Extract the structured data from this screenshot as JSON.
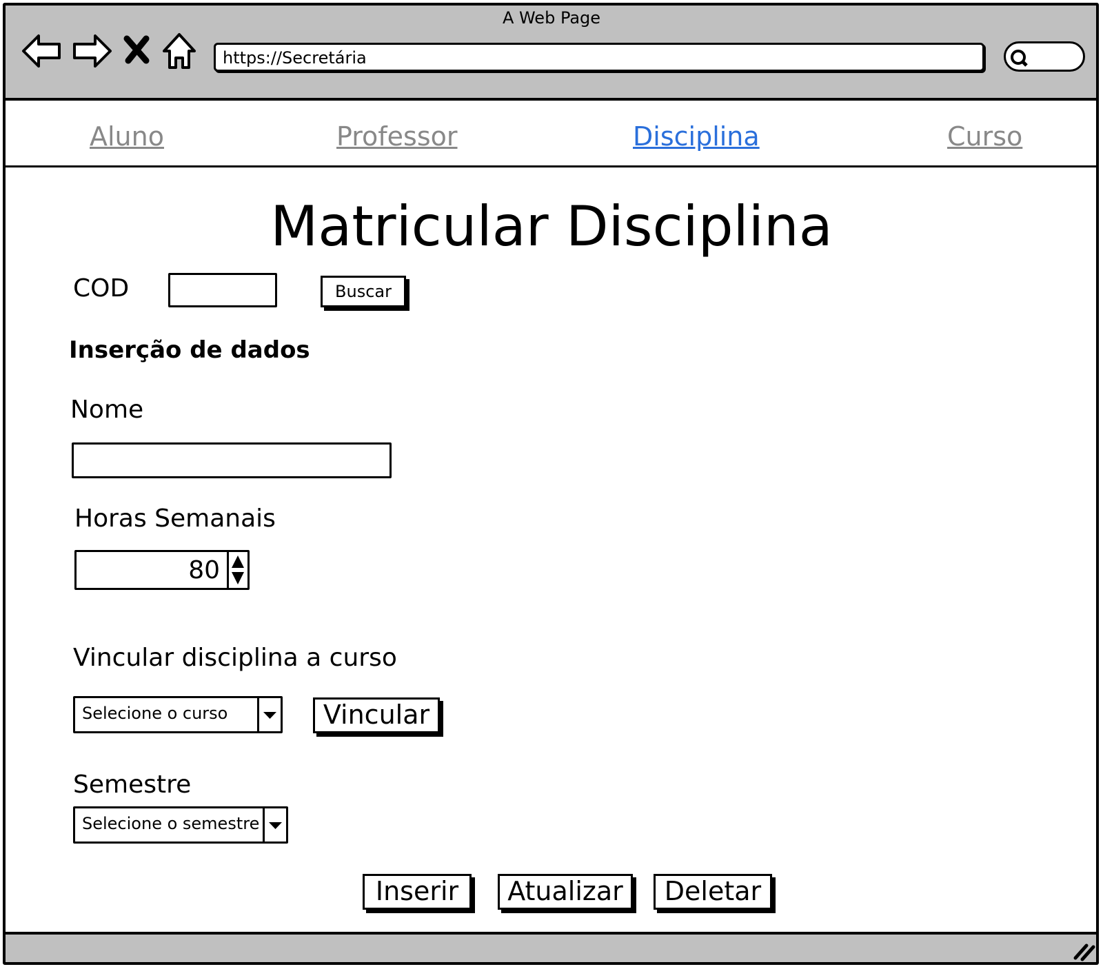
{
  "window": {
    "title": "A Web Page"
  },
  "browser": {
    "url": "https://Secretária",
    "icons": [
      "back-icon",
      "forward-icon",
      "close-icon",
      "home-icon",
      "search-icon",
      "resize-grip-icon"
    ]
  },
  "tabs": [
    {
      "label": "Aluno",
      "active": false
    },
    {
      "label": "Professor",
      "active": false
    },
    {
      "label": "Disciplina",
      "active": true
    },
    {
      "label": "Curso",
      "active": false
    }
  ],
  "page": {
    "title": "Matricular Disciplina",
    "cod_label": "COD",
    "cod_value": "",
    "search_button": "Buscar",
    "section_heading": "Inserção de dados",
    "nome_label": "Nome",
    "nome_value": "",
    "horas_label": "Horas Semanais",
    "horas_value": "80",
    "vincular_label": "Vincular disciplina a curso",
    "curso_select": "Selecione o curso",
    "vincular_button": "Vincular",
    "semestre_label": "Semestre",
    "semestre_select": "Selecione o semestre",
    "actions": {
      "insert": "Inserir",
      "update": "Atualizar",
      "delete": "Deletar"
    }
  },
  "colors": {
    "chrome": "#c0c0c0",
    "active_tab": "#2a6fdb",
    "inactive_tab": "#888888"
  }
}
